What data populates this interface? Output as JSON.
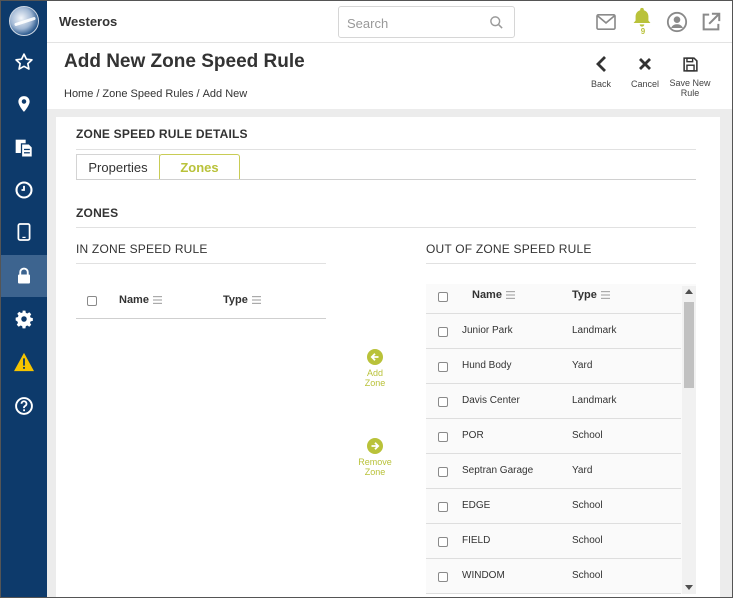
{
  "header": {
    "org_name": "Westeros",
    "search_placeholder": "Search",
    "notification_count": "9"
  },
  "sidebar": {
    "items": [
      {
        "icon": "star-icon"
      },
      {
        "icon": "location-pin-icon"
      },
      {
        "icon": "documents-icon"
      },
      {
        "icon": "clock-icon"
      },
      {
        "icon": "tablet-icon"
      },
      {
        "icon": "lock-icon",
        "active": true
      },
      {
        "icon": "gear-icon"
      },
      {
        "icon": "warning-icon"
      },
      {
        "icon": "help-icon"
      }
    ]
  },
  "page": {
    "title": "Add New Zone Speed Rule",
    "breadcrumb": [
      "Home",
      "Zone Speed Rules",
      "Add New"
    ],
    "breadcrumb_sep": "/",
    "actions": {
      "back": "Back",
      "cancel": "Cancel",
      "save_line1": "Save New",
      "save_line2": "Rule"
    }
  },
  "details": {
    "section_title": "ZONE SPEED RULE DETAILS",
    "tabs": [
      {
        "label": "Properties",
        "active": false
      },
      {
        "label": "Zones",
        "active": true
      }
    ],
    "zones_title": "ZONES"
  },
  "in_zone": {
    "title": "IN ZONE SPEED RULE",
    "col_name": "Name",
    "col_type": "Type"
  },
  "move": {
    "add_line1": "Add",
    "add_line2": "Zone",
    "remove_line1": "Remove",
    "remove_line2": "Zone"
  },
  "out_zone": {
    "title": "OUT OF ZONE SPEED RULE",
    "col_name": "Name",
    "col_type": "Type",
    "rows": [
      {
        "name": "Junior Park",
        "type": "Landmark"
      },
      {
        "name": "Hund Body",
        "type": "Yard"
      },
      {
        "name": "Davis Center",
        "type": "Landmark"
      },
      {
        "name": "POR",
        "type": "School"
      },
      {
        "name": "Septran Garage",
        "type": "Yard"
      },
      {
        "name": "EDGE",
        "type": "School"
      },
      {
        "name": "FIELD",
        "type": "School"
      },
      {
        "name": "WINDOM",
        "type": "School"
      }
    ]
  },
  "colors": {
    "sidebar": "#0d3a6b",
    "accent": "#b9c23a",
    "warning": "#f5c400"
  }
}
